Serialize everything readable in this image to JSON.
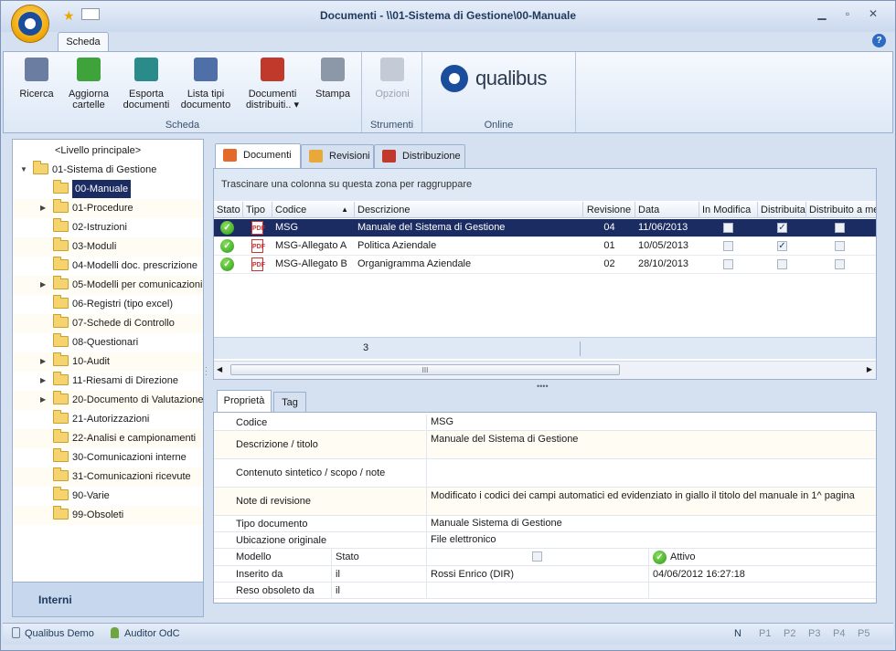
{
  "window": {
    "title": "Documenti - \\\\01-Sistema di Gestione\\00-Manuale"
  },
  "ribbon": {
    "tab": "Scheda",
    "groups": {
      "scheda": "Scheda",
      "strumenti": "Strumenti",
      "online": "Online"
    },
    "buttons": {
      "ricerca": "Ricerca",
      "aggiorna_1": "Aggiorna",
      "aggiorna_2": "cartelle",
      "esporta_1": "Esporta",
      "esporta_2": "documenti",
      "lista_1": "Lista tipi",
      "lista_2": "documento",
      "distrib_1": "Documenti",
      "distrib_2": "distribuiti..",
      "stampa": "Stampa",
      "opzioni": "Opzioni"
    },
    "logo_text": "qualibus"
  },
  "tree": {
    "root": "<Livello principale>",
    "parent": "01-Sistema di Gestione",
    "items": [
      {
        "label": "00-Manuale",
        "exp": ""
      },
      {
        "label": "01-Procedure",
        "exp": "▶"
      },
      {
        "label": "02-Istruzioni",
        "exp": ""
      },
      {
        "label": "03-Moduli",
        "exp": ""
      },
      {
        "label": "04-Modelli doc. prescrizione",
        "exp": ""
      },
      {
        "label": "05-Modelli per comunicazioni",
        "exp": "▶"
      },
      {
        "label": "06-Registri (tipo excel)",
        "exp": ""
      },
      {
        "label": "07-Schede di Controllo",
        "exp": ""
      },
      {
        "label": "08-Questionari",
        "exp": ""
      },
      {
        "label": "10-Audit",
        "exp": "▶"
      },
      {
        "label": "11-Riesami di Direzione",
        "exp": "▶"
      },
      {
        "label": "20-Documento di Valutazione",
        "exp": "▶"
      },
      {
        "label": "21-Autorizzazioni",
        "exp": ""
      },
      {
        "label": "22-Analisi e campionamenti",
        "exp": ""
      },
      {
        "label": "30-Comunicazioni interne",
        "exp": ""
      },
      {
        "label": "31-Comunicazioni ricevute",
        "exp": ""
      },
      {
        "label": "90-Varie",
        "exp": ""
      },
      {
        "label": "99-Obsoleti",
        "exp": ""
      }
    ],
    "footer": "Interni"
  },
  "doc_tabs": [
    "Documenti",
    "Revisioni",
    "Distribuzione"
  ],
  "grid": {
    "group_hint": "Trascinare una colonna su questa zona per raggruppare",
    "columns": [
      "Stato",
      "Tipo",
      "Codice",
      "Descrizione",
      "Revisione",
      "Data",
      "In Modifica",
      "Distribuita",
      "Distribuito a me"
    ],
    "rows": [
      {
        "codice": "MSG",
        "descrizione": "Manuale del Sistema di Gestione",
        "revisione": "04",
        "data": "11/06/2013",
        "in_modifica": false,
        "distribuita": true,
        "distribuito_me": false
      },
      {
        "codice": "MSG-Allegato A",
        "descrizione": "Politica Aziendale",
        "revisione": "01",
        "data": "10/05/2013",
        "in_modifica": false,
        "distribuita": true,
        "distribuito_me": false
      },
      {
        "codice": "MSG-Allegato B",
        "descrizione": "Organigramma Aziendale",
        "revisione": "02",
        "data": "28/10/2013",
        "in_modifica": false,
        "distribuita": false,
        "distribuito_me": false
      }
    ],
    "count": "3",
    "scroll_mark": "III"
  },
  "prop_tabs": [
    "Proprietà",
    "Tag"
  ],
  "props": {
    "codice_l": "Codice",
    "codice_v": "MSG",
    "descr_l": "Descrizione / titolo",
    "descr_v": "Manuale del Sistema di Gestione",
    "cont_l": "Contenuto sintetico / scopo / note",
    "note_l": "Note di revisione",
    "note_v": "Modificato i codici dei campi automatici ed evidenziato in giallo il titolo del manuale in 1^ pagina",
    "tipo_l": "Tipo documento",
    "tipo_v": "Manuale Sistema di Gestione",
    "ubic_l": "Ubicazione originale",
    "ubic_v": "File elettronico",
    "modello_l": "Modello",
    "stato_l": "Stato",
    "stato_v": "Attivo",
    "ins_l": "Inserito da",
    "ins_il": "il",
    "ins_v": "Rossi Enrico (DIR)",
    "ins_date": "04/06/2012 16:27:18",
    "obs_l": "Reso obsoleto da",
    "obs_il": "il"
  },
  "status": {
    "user1": "Qualibus Demo",
    "user2": "Auditor OdC",
    "keys": [
      "N",
      "P1",
      "P2",
      "P3",
      "P4",
      "P5"
    ]
  },
  "colors": {
    "selection": "#1b2c63",
    "accent": "#1a4e9c",
    "frame": "#d5e1f1"
  }
}
